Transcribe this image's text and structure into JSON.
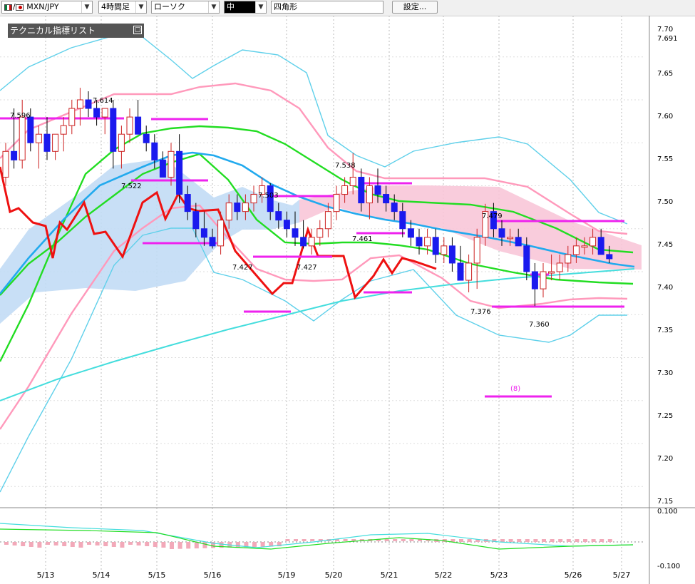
{
  "toolbar": {
    "symbol": "MXN/JPY",
    "timeframe": "4時間足",
    "chart_style": "ローソク",
    "size": "中",
    "drawing_tool": "四角形",
    "settings_label": "設定..."
  },
  "tech_list_label": "テクニカル指標リスト",
  "colors": {
    "bull": "#cc2222",
    "bear": "#1a1aee",
    "bb_outer": "#5fd0ea",
    "bb_inner": "#ff99bb",
    "ma_short": "#22dd22",
    "ma_mid": "#22aaee",
    "ma_long": "#44dddd",
    "red_line": "#ee1111",
    "magenta": "#ee22ee",
    "cloud_blue": "#c2dbf5",
    "cloud_pink": "#f8c6d8"
  },
  "chart_data": {
    "type": "candlestick",
    "symbol": "MXN/JPY",
    "timeframe": "4時間足",
    "y_ticks": [
      "7.70",
      "7.691",
      "7.65",
      "7.60",
      "7.55",
      "7.50",
      "7.45",
      "7.40",
      "7.35",
      "7.30",
      "7.25",
      "7.20",
      "7.15"
    ],
    "x_dates": [
      "5/13",
      "5/14",
      "5/15",
      "5/16",
      "5/19",
      "5/20",
      "5/21",
      "5/22",
      "5/23",
      "5/26",
      "5/27"
    ],
    "annotations": [
      "7.596",
      "7.614",
      "7.522",
      "7.503",
      "7.427",
      "7.427",
      "7.538",
      "7.461",
      "7.479",
      "7.376",
      "7.360",
      "(8)"
    ],
    "sub_ticks": [
      "0.100",
      "-0.100"
    ],
    "candles": [
      [
        7.51,
        7.55,
        7.5,
        7.54
      ],
      [
        7.54,
        7.59,
        7.52,
        7.53
      ],
      [
        7.53,
        7.6,
        7.52,
        7.58
      ],
      [
        7.58,
        7.59,
        7.54,
        7.55
      ],
      [
        7.55,
        7.57,
        7.52,
        7.56
      ],
      [
        7.56,
        7.58,
        7.53,
        7.54
      ],
      [
        7.54,
        7.56,
        7.53,
        7.56
      ],
      [
        7.56,
        7.58,
        7.54,
        7.57
      ],
      [
        7.57,
        7.6,
        7.56,
        7.59
      ],
      [
        7.59,
        7.614,
        7.57,
        7.6
      ],
      [
        7.6,
        7.61,
        7.58,
        7.59
      ],
      [
        7.59,
        7.6,
        7.57,
        7.58
      ],
      [
        7.58,
        7.59,
        7.56,
        7.59
      ],
      [
        7.59,
        7.6,
        7.52,
        7.54
      ],
      [
        7.54,
        7.57,
        7.52,
        7.56
      ],
      [
        7.56,
        7.59,
        7.55,
        7.58
      ],
      [
        7.58,
        7.6,
        7.56,
        7.56
      ],
      [
        7.56,
        7.57,
        7.54,
        7.55
      ],
      [
        7.55,
        7.56,
        7.52,
        7.53
      ],
      [
        7.53,
        7.54,
        7.51,
        7.51
      ],
      [
        7.51,
        7.55,
        7.5,
        7.54
      ],
      [
        7.54,
        7.56,
        7.48,
        7.49
      ],
      [
        7.49,
        7.5,
        7.46,
        7.47
      ],
      [
        7.47,
        7.48,
        7.44,
        7.45
      ],
      [
        7.45,
        7.47,
        7.43,
        7.44
      ],
      [
        7.44,
        7.45,
        7.427,
        7.43
      ],
      [
        7.43,
        7.47,
        7.42,
        7.46
      ],
      [
        7.46,
        7.49,
        7.45,
        7.48
      ],
      [
        7.48,
        7.49,
        7.46,
        7.47
      ],
      [
        7.47,
        7.49,
        7.46,
        7.48
      ],
      [
        7.48,
        7.5,
        7.47,
        7.49
      ],
      [
        7.49,
        7.51,
        7.48,
        7.5
      ],
      [
        7.5,
        7.503,
        7.46,
        7.47
      ],
      [
        7.47,
        7.48,
        7.45,
        7.46
      ],
      [
        7.46,
        7.47,
        7.44,
        7.45
      ],
      [
        7.45,
        7.47,
        7.43,
        7.44
      ],
      [
        7.44,
        7.46,
        7.427,
        7.43
      ],
      [
        7.43,
        7.45,
        7.42,
        7.44
      ],
      [
        7.44,
        7.46,
        7.43,
        7.45
      ],
      [
        7.45,
        7.48,
        7.44,
        7.47
      ],
      [
        7.47,
        7.5,
        7.46,
        7.49
      ],
      [
        7.49,
        7.51,
        7.48,
        7.5
      ],
      [
        7.5,
        7.538,
        7.49,
        7.51
      ],
      [
        7.51,
        7.52,
        7.47,
        7.48
      ],
      [
        7.48,
        7.51,
        7.461,
        7.5
      ],
      [
        7.5,
        7.52,
        7.48,
        7.49
      ],
      [
        7.49,
        7.5,
        7.47,
        7.48
      ],
      [
        7.48,
        7.49,
        7.46,
        7.47
      ],
      [
        7.47,
        7.48,
        7.44,
        7.45
      ],
      [
        7.45,
        7.46,
        7.43,
        7.44
      ],
      [
        7.44,
        7.45,
        7.42,
        7.43
      ],
      [
        7.43,
        7.45,
        7.42,
        7.44
      ],
      [
        7.44,
        7.45,
        7.41,
        7.42
      ],
      [
        7.42,
        7.44,
        7.41,
        7.43
      ],
      [
        7.43,
        7.44,
        7.4,
        7.41
      ],
      [
        7.41,
        7.43,
        7.39,
        7.39
      ],
      [
        7.39,
        7.42,
        7.376,
        7.41
      ],
      [
        7.41,
        7.45,
        7.38,
        7.44
      ],
      [
        7.44,
        7.479,
        7.43,
        7.47
      ],
      [
        7.47,
        7.48,
        7.44,
        7.45
      ],
      [
        7.45,
        7.46,
        7.43,
        7.44
      ],
      [
        7.44,
        7.45,
        7.43,
        7.44
      ],
      [
        7.44,
        7.45,
        7.43,
        7.43
      ],
      [
        7.43,
        7.44,
        7.39,
        7.4
      ],
      [
        7.4,
        7.41,
        7.36,
        7.38
      ],
      [
        7.38,
        7.41,
        7.37,
        7.4
      ],
      [
        7.4,
        7.42,
        7.39,
        7.4
      ],
      [
        7.4,
        7.42,
        7.39,
        7.41
      ],
      [
        7.41,
        7.43,
        7.4,
        7.42
      ],
      [
        7.42,
        7.44,
        7.41,
        7.43
      ],
      [
        7.43,
        7.44,
        7.42,
        7.43
      ],
      [
        7.43,
        7.45,
        7.42,
        7.44
      ],
      [
        7.44,
        7.45,
        7.42,
        7.42
      ],
      [
        7.42,
        7.43,
        7.41,
        7.415
      ]
    ]
  }
}
